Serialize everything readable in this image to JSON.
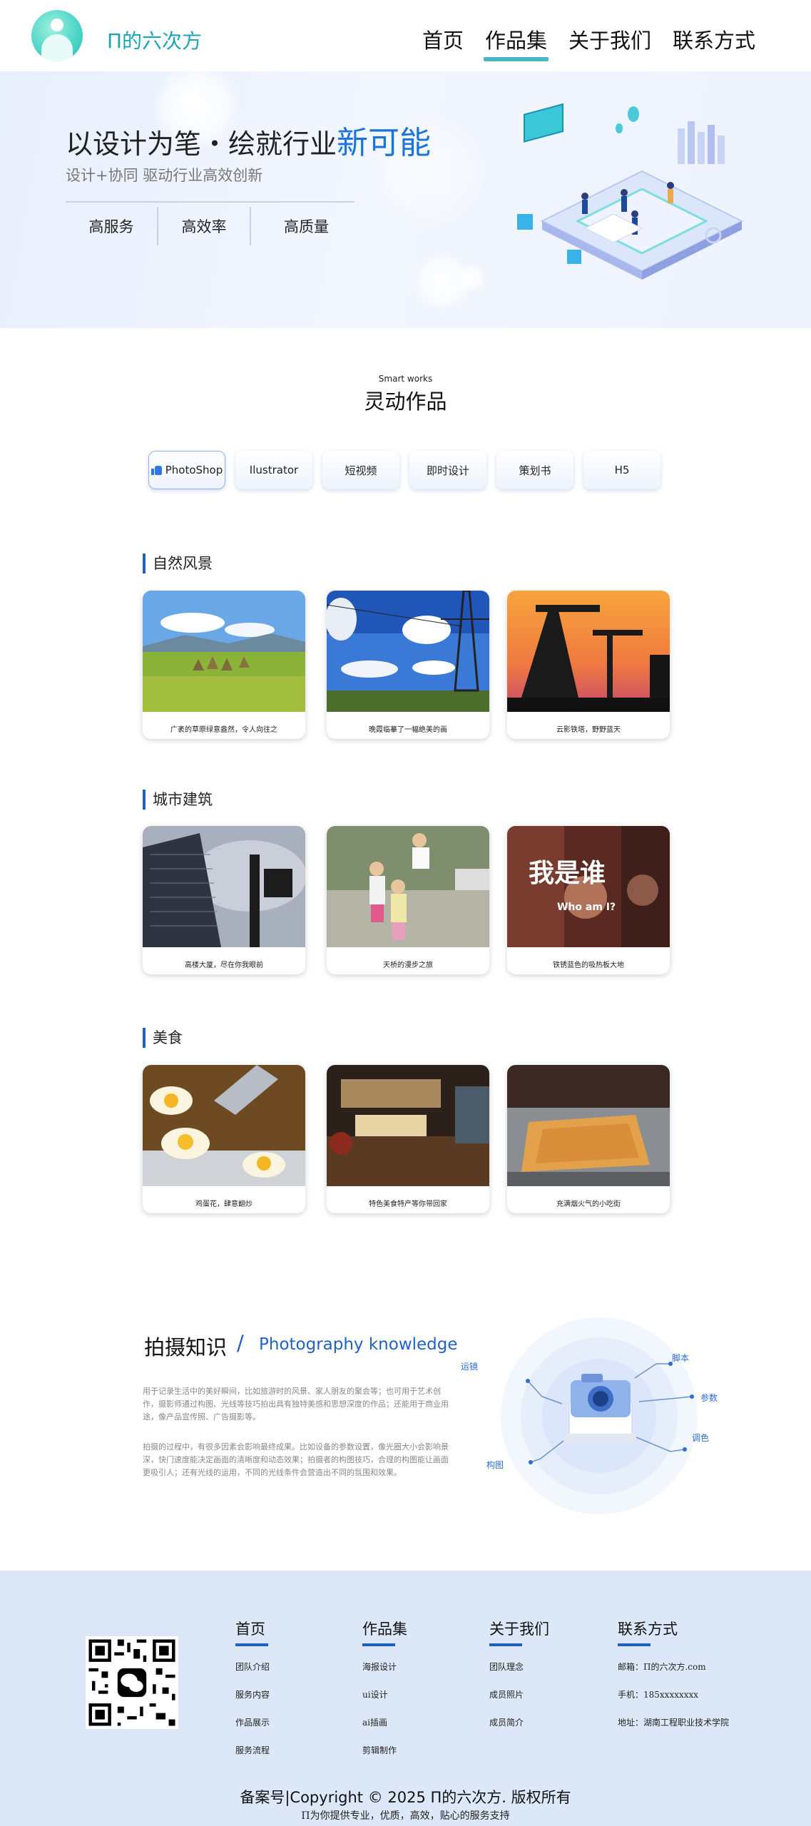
{
  "header": {
    "logo_text": "Π的六次方",
    "nav": [
      "首页",
      "作品集",
      "关于我们",
      "联系方式"
    ],
    "active_nav": "作品集"
  },
  "hero": {
    "title_main": "以设计为笔・绘就行业",
    "title_highlight": "新可能",
    "subtitle": "设计+协同 驱动行业高效创新",
    "stats": [
      "高服务",
      "高效率",
      "高质量"
    ]
  },
  "works": {
    "title_en": "Smart works",
    "title_cn": "灵动作品",
    "tabs": [
      "PhotoShop",
      "Ilustrator",
      "短视频",
      "即时设计",
      "策划书",
      "H5"
    ],
    "active_tab": "PhotoShop",
    "categories": [
      {
        "name": "自然风景",
        "cards": [
          {
            "caption": "广袤的草原绿意盎然，令人向往之"
          },
          {
            "caption": "晚霞临摹了一幅绝美的画"
          },
          {
            "caption": "云影铁塔，野野蓝天"
          }
        ]
      },
      {
        "name": "城市建筑",
        "cards": [
          {
            "caption": "高楼大厦，尽在你我眼前"
          },
          {
            "caption": "天桥的漫步之旅"
          },
          {
            "caption": "铁锈蓝色的吸热板大地"
          }
        ]
      },
      {
        "name": "美食",
        "cards": [
          {
            "caption": "鸡蛋花，肆意翻炒"
          },
          {
            "caption": "特色美食特产等你带回家"
          },
          {
            "caption": "充满烟火气的小吃街"
          }
        ]
      }
    ]
  },
  "knowledge": {
    "title_cn": "拍摄知识",
    "slash": "/",
    "title_en": "Photography knowledge",
    "para1": "用于记录生活中的美好瞬间，比如旅游时的风景、家人朋友的聚会等；也可用于艺术创作，摄影师通过构图、光线等技巧拍出具有独特美感和思想深度的作品；还能用于商业用途，像产品宣传照、广告摄影等。",
    "para2": "拍摄的过程中，有很多因素会影响最终成果。比如设备的参数设置，像光圈大小会影响景深，快门速度能决定画面的清晰度和动态效果；拍摄者的构图技巧，合理的构图能让画面更吸引人；还有光线的运用，不同的光线条件会营造出不同的氛围和效果。",
    "labels": [
      "脚本",
      "运镜",
      "参数",
      "调色",
      "构图"
    ]
  },
  "footer": {
    "columns": [
      {
        "title": "首页",
        "items": [
          "团队介绍",
          "服务内容",
          "作品展示",
          "服务流程"
        ]
      },
      {
        "title": "作品集",
        "items": [
          "海报设计",
          "ui设计",
          "ai插画",
          "剪辑制作"
        ]
      },
      {
        "title": "关于我们",
        "items": [
          "团队理念",
          "成员照片",
          "成员简介"
        ]
      },
      {
        "title": "联系方式",
        "items": [
          "邮箱：Π的六次方.com",
          "手机：185xxxxxxxx",
          "地址：湖南工程职业技术学院"
        ]
      }
    ],
    "copyright": "备案号|Copyright © 2025 Π的六次方. 版权所有",
    "tagline": "Π为你提供专业，优质，高效，贴心的服务支持"
  }
}
